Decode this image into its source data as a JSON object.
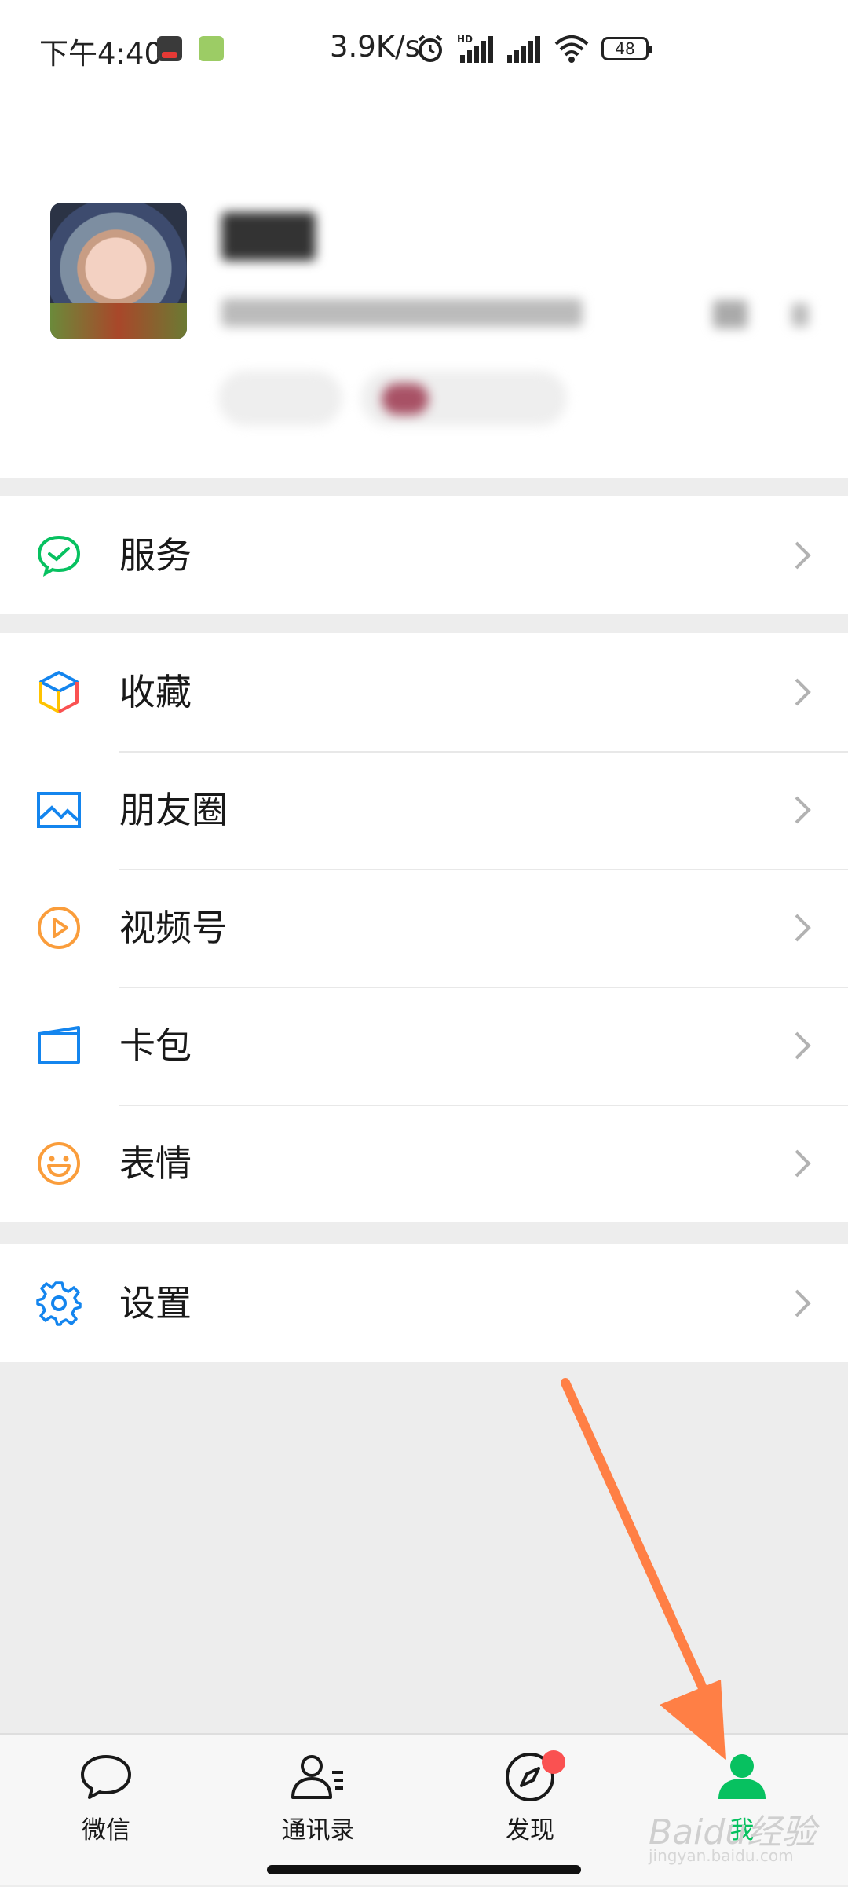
{
  "status_bar": {
    "time": "下午4:40",
    "network_speed": "3.9K/s",
    "battery": "48",
    "icons": [
      "qq-icon",
      "app-icon",
      "alarm-icon",
      "hd-signal-icon",
      "signal-icon",
      "wifi-icon",
      "battery-icon"
    ]
  },
  "menu": {
    "group1": [
      {
        "label": "服务",
        "icon": "service-icon",
        "color": "#07c160"
      }
    ],
    "group2": [
      {
        "label": "收藏",
        "icon": "favorites-cube-icon",
        "color": "#fa9d3b"
      },
      {
        "label": "朋友圈",
        "icon": "moments-icon",
        "color": "#1485ee"
      },
      {
        "label": "视频号",
        "icon": "channels-icon",
        "color": "#fa9d3b"
      },
      {
        "label": "卡包",
        "icon": "card-icon",
        "color": "#1485ee"
      },
      {
        "label": "表情",
        "icon": "sticker-icon",
        "color": "#fa9d3b"
      }
    ],
    "group3": [
      {
        "label": "设置",
        "icon": "settings-gear-icon",
        "color": "#1485ee"
      }
    ]
  },
  "tabs": [
    {
      "label": "微信",
      "icon": "chat-bubble-icon",
      "active": false
    },
    {
      "label": "通讯录",
      "icon": "contacts-icon",
      "active": false
    },
    {
      "label": "发现",
      "icon": "compass-icon",
      "active": false,
      "badge": true
    },
    {
      "label": "我",
      "icon": "me-person-icon",
      "active": true
    }
  ],
  "colors": {
    "accent": "#07c160",
    "badge": "#fa5151",
    "annotation_arrow": "#ff7f45"
  },
  "watermark": {
    "text": "Baidu经验",
    "sub": "jingyan.baidu.com"
  }
}
